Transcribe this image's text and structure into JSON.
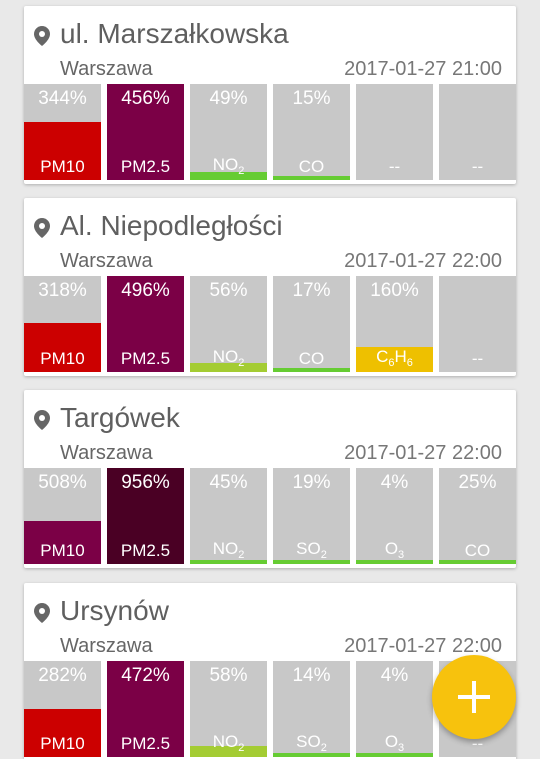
{
  "stations": [
    {
      "street": "ul. Marszałkowska",
      "city": "Warszawa",
      "timestamp": "2017-01-27 21:00",
      "readings": [
        {
          "percent": "344%",
          "name": "PM10",
          "sub": "",
          "level": 0.75,
          "color": "#cc0000"
        },
        {
          "percent": "456%",
          "name": "PM2.5",
          "sub": "",
          "level": 1.0,
          "color": "#7b0046"
        },
        {
          "percent": "49%",
          "name": "NO",
          "sub": "2",
          "level": 0.1,
          "color": "#66cc33"
        },
        {
          "percent": "15%",
          "name": "CO",
          "sub": "",
          "level": 0.04,
          "color": "#66cc33"
        },
        {
          "percent": "",
          "name": "--",
          "sub": "",
          "level": 0,
          "color": "#c8c8c8"
        },
        {
          "percent": "",
          "name": "--",
          "sub": "",
          "level": 0,
          "color": "#c8c8c8"
        }
      ]
    },
    {
      "street": "Al. Niepodległości",
      "city": "Warszawa",
      "timestamp": "2017-01-27 22:00",
      "readings": [
        {
          "percent": "318%",
          "name": "PM10",
          "sub": "",
          "level": 0.64,
          "color": "#cc0000"
        },
        {
          "percent": "496%",
          "name": "PM2.5",
          "sub": "",
          "level": 1.0,
          "color": "#7b0046"
        },
        {
          "percent": "56%",
          "name": "NO",
          "sub": "2",
          "level": 0.12,
          "color": "#a4cc33"
        },
        {
          "percent": "17%",
          "name": "CO",
          "sub": "",
          "level": 0.04,
          "color": "#66cc33"
        },
        {
          "percent": "160%",
          "name": "C",
          "sub": "6",
          "name2": "H",
          "sub2": "6",
          "level": 0.33,
          "color": "#eec000"
        },
        {
          "percent": "",
          "name": "--",
          "sub": "",
          "level": 0,
          "color": "#c8c8c8"
        }
      ]
    },
    {
      "street": "Targówek",
      "city": "Warszawa",
      "timestamp": "2017-01-27 22:00",
      "readings": [
        {
          "percent": "508%",
          "name": "PM10",
          "sub": "",
          "level": 0.56,
          "color": "#7b0046"
        },
        {
          "percent": "956%",
          "name": "PM2.5",
          "sub": "",
          "level": 1.0,
          "color": "#4a0024"
        },
        {
          "percent": "45%",
          "name": "NO",
          "sub": "2",
          "level": 0.05,
          "color": "#66cc33"
        },
        {
          "percent": "19%",
          "name": "SO",
          "sub": "2",
          "level": 0.03,
          "color": "#66cc33"
        },
        {
          "percent": "4%",
          "name": "O",
          "sub": "3",
          "level": 0.03,
          "color": "#66cc33"
        },
        {
          "percent": "25%",
          "name": "CO",
          "sub": "",
          "level": 0.03,
          "color": "#66cc33"
        }
      ]
    },
    {
      "street": "Ursynów",
      "city": "Warszawa",
      "timestamp": "2017-01-27 22:00",
      "readings": [
        {
          "percent": "282%",
          "name": "PM10",
          "sub": "",
          "level": 0.62,
          "color": "#cc0000"
        },
        {
          "percent": "472%",
          "name": "PM2.5",
          "sub": "",
          "level": 1.0,
          "color": "#7b0046"
        },
        {
          "percent": "58%",
          "name": "NO",
          "sub": "2",
          "level": 0.14,
          "color": "#a4cc33"
        },
        {
          "percent": "14%",
          "name": "SO",
          "sub": "2",
          "level": 0.03,
          "color": "#66cc33"
        },
        {
          "percent": "4%",
          "name": "O",
          "sub": "3",
          "level": 0.03,
          "color": "#66cc33"
        },
        {
          "percent": "",
          "name": "--",
          "sub": "",
          "level": 0,
          "color": "#c8c8c8"
        }
      ]
    }
  ],
  "fab": {
    "icon": "plus-icon"
  }
}
